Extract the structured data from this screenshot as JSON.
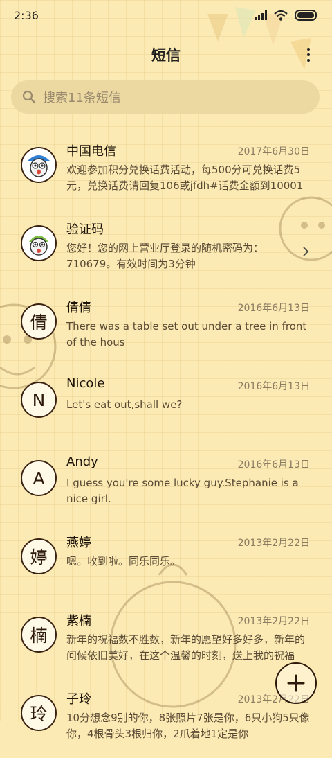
{
  "status": {
    "time": "2:36"
  },
  "header": {
    "title": "短信"
  },
  "search": {
    "placeholder": "搜索11条短信"
  },
  "conversations": [
    {
      "name": "中国电信",
      "date": "2017年6月30日",
      "preview": "欢迎参加积分兑换话费活动，每500分可兑换话费5元，兑换话费请回复106或jfdh#话费金额到10001"
    },
    {
      "name": "验证码",
      "date": "",
      "preview": "您好！您的网上营业厅登录的随机密码为：710679。有效时间为3分钟"
    },
    {
      "name": "倩倩",
      "date": "2016年6月13日",
      "avatar": "倩",
      "preview": "There was a table set out under a tree in front of the hous"
    },
    {
      "name": "Nicole",
      "date": "2016年6月13日",
      "avatar": "N",
      "preview": "Let's eat out,shall we?"
    },
    {
      "name": "Andy",
      "date": "2016年6月13日",
      "avatar": "A",
      "preview": "I guess you're some lucky guy.Stephanie is a nice girl."
    },
    {
      "name": "燕婷",
      "date": "2013年2月22日",
      "avatar": "婷",
      "preview": "嗯。收到啦。同乐同乐。"
    },
    {
      "name": "紫楠",
      "date": "2013年2月22日",
      "avatar": "楠",
      "preview": "新年的祝福数不胜数，新年的愿望好多好多，新年的问候依旧美好，在这个温馨的时刻，送上我的祝福"
    },
    {
      "name": "子玲",
      "date": "2013年2月22日",
      "avatar": "玲",
      "preview": "10分想念9别的你，8张照片7张是你，6只小狗5只像你，4根骨头3根归你，2爪着地1定是你"
    }
  ]
}
